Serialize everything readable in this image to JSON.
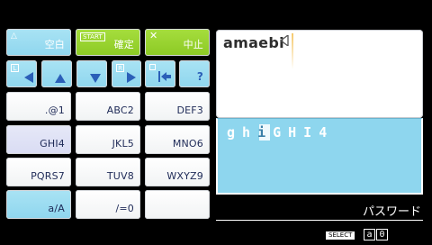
{
  "keyboard": {
    "row1": [
      {
        "corner": "△",
        "label": "空白"
      },
      {
        "corner": "START",
        "label": "確定"
      },
      {
        "corner": "✕",
        "label": "中止"
      }
    ],
    "row2": {
      "l_tag": "L",
      "r_tag": "R",
      "backspace_corner": "□",
      "help_label": "?"
    },
    "keys": [
      ".@1",
      "ABC2",
      "DEF3",
      "GHI4",
      "JKL5",
      "MNO6",
      "PQRS7",
      "TUV8",
      "WXYZ9",
      "a/A",
      "/=0",
      ""
    ]
  },
  "user": {
    "name": "amaebi"
  },
  "password": {
    "chars": [
      "g",
      "h",
      "i",
      "G",
      "H",
      "I",
      "4"
    ]
  },
  "mode": {
    "label": "パスワード"
  },
  "footer": {
    "select": "SELECT",
    "modes": [
      "a",
      "0"
    ]
  },
  "colors": {
    "green": "#8cc924",
    "cyan": "#8ed6ee",
    "lavender": "#d9dcf3",
    "text": "#1e2a57"
  }
}
